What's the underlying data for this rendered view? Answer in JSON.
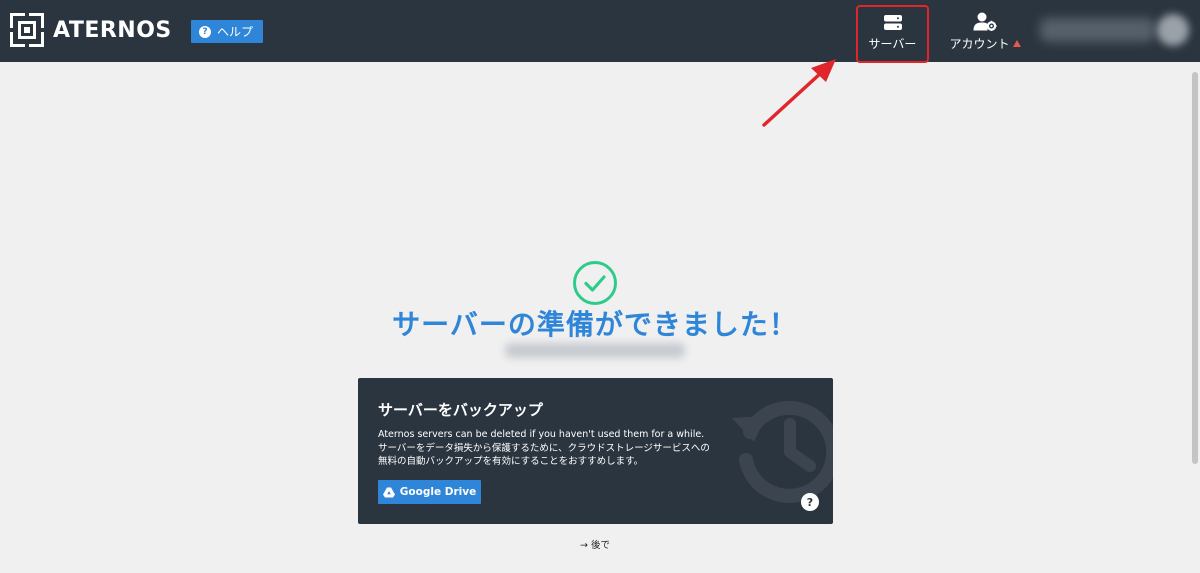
{
  "header": {
    "brand": "ATERNOS",
    "help_label": "ヘルプ",
    "help_icon_glyph": "?",
    "nav": {
      "servers_label": "サーバー",
      "account_label": "アカウント"
    }
  },
  "main": {
    "title": "サーバーの準備ができました！",
    "backup": {
      "title": "サーバーをバックアップ",
      "line1": "Aternos servers can be deleted if you haven't used them for a while.",
      "line2": "サーバーをデータ損失から保護するために、クラウドストレージサービスへの",
      "line3": "無料の自動バックアップを有効にすることをおすすめします。",
      "button_label": "Google Drive",
      "help_glyph": "?"
    },
    "later_arrow": "→",
    "later_label": "後で"
  },
  "colors": {
    "header_bg": "#2b3540",
    "accent_blue": "#2f86d8",
    "success_green": "#2ecc8a",
    "highlight_red": "#e0262a",
    "warning": "#e8594c"
  },
  "icons": {
    "logo": "aternos-logo-icon",
    "servers": "server-stack-icon",
    "account": "user-gear-icon",
    "success": "check-circle-icon",
    "backup_watermark": "history-icon",
    "drive": "google-drive-icon",
    "help": "question-circle-icon"
  }
}
